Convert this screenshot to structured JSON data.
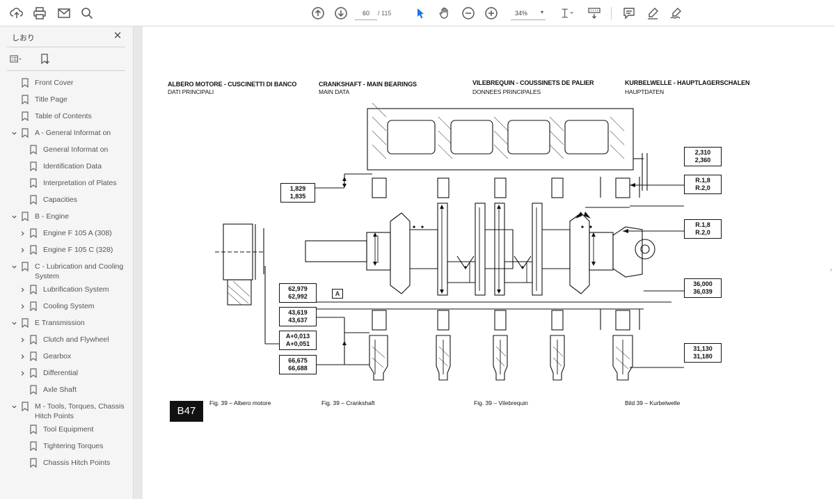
{
  "toolbar": {
    "page_current": "60",
    "page_total": "/ 115",
    "zoom": "34%",
    "icons": [
      "upload-cloud-icon",
      "print-icon",
      "email-icon",
      "search-icon",
      "page-up-icon",
      "page-down-icon",
      "select-cursor-icon",
      "hand-pan-icon",
      "zoom-out-icon",
      "zoom-in-icon",
      "fit-page-icon",
      "keyboard-scroll-icon",
      "comment-icon",
      "highlight-pen-icon",
      "sign-icon"
    ]
  },
  "sidebar": {
    "title": "しおり",
    "close": "✕",
    "bookmarks": [
      {
        "label": "Front Cover",
        "level": 0,
        "toggle": "none"
      },
      {
        "label": "Title Page",
        "level": 0,
        "toggle": "none"
      },
      {
        "label": "Table of Contents",
        "level": 0,
        "toggle": "none"
      },
      {
        "label": "A - General Informat on",
        "level": 0,
        "toggle": "expanded"
      },
      {
        "label": "General Informat on",
        "level": 1,
        "toggle": "none"
      },
      {
        "label": "Identification Data",
        "level": 1,
        "toggle": "none"
      },
      {
        "label": "Interpretation of Plates",
        "level": 1,
        "toggle": "none"
      },
      {
        "label": "Capacities",
        "level": 1,
        "toggle": "none"
      },
      {
        "label": "B - Engine",
        "level": 0,
        "toggle": "expanded"
      },
      {
        "label": "Engine F 105 A (308)",
        "level": 1,
        "toggle": "collapsed"
      },
      {
        "label": "Engine F 105 C (328)",
        "level": 1,
        "toggle": "collapsed"
      },
      {
        "label": "C - Lubrication and Cooling System",
        "level": 0,
        "toggle": "expanded"
      },
      {
        "label": "Lubrification System",
        "level": 1,
        "toggle": "collapsed"
      },
      {
        "label": "Cooling System",
        "level": 1,
        "toggle": "collapsed"
      },
      {
        "label": "E   Transmission",
        "level": 0,
        "toggle": "expanded"
      },
      {
        "label": "Clutch and Flywheel",
        "level": 1,
        "toggle": "collapsed"
      },
      {
        "label": "Gearbox",
        "level": 1,
        "toggle": "collapsed"
      },
      {
        "label": "Differential",
        "level": 1,
        "toggle": "collapsed"
      },
      {
        "label": "Axle Shaft",
        "level": 1,
        "toggle": "none"
      },
      {
        "label": "M - Tools, Torques, Chassis Hitch Points",
        "level": 0,
        "toggle": "expanded"
      },
      {
        "label": "Tool Equipment",
        "level": 1,
        "toggle": "none"
      },
      {
        "label": "Tightering Torques",
        "level": 1,
        "toggle": "none"
      },
      {
        "label": "Chassis Hitch Points",
        "level": 1,
        "toggle": "none"
      }
    ]
  },
  "document": {
    "headers": {
      "it_title": "ALBERO MOTORE - CUSCINETTI DI BANCO",
      "it_sub": "DATI PRINCIPALI",
      "en_title": "CRANKSHAFT - MAIN BEARINGS",
      "en_sub": "MAIN DATA",
      "fr_title": "VILEBREQUIN - COUSSINETS DE PALIER",
      "fr_sub": "DONNEES PRINCIPALES",
      "de_title": "KURBELWELLE - HAUPTLAGERSCHALEN",
      "de_sub": "HAUPTDATEN"
    },
    "dims": {
      "d1": [
        "2,310",
        "2,360"
      ],
      "d2": [
        "1,829",
        "1,835"
      ],
      "d3": [
        "R.1,8",
        "R.2,0"
      ],
      "d4": [
        "R.1,8",
        "R.2,0"
      ],
      "d5": [
        "62,979",
        "62,992"
      ],
      "d6": [
        "43,619",
        "43,637"
      ],
      "d7": [
        "A+0,013",
        "A+0,051"
      ],
      "d8": [
        "66,675",
        "66,688"
      ],
      "d9": [
        "36,000",
        "36,039"
      ],
      "d10": [
        "31,130",
        "31,180"
      ],
      "a_label": "A"
    },
    "page_tag": "B47",
    "captions": {
      "it": "Fig. 39 – Albero motore",
      "en": "Fig. 39 – Crankshaft",
      "fr": "Fig. 39 – Vilebrequin",
      "de": "Bild  39 – Kurbelwelle"
    }
  }
}
